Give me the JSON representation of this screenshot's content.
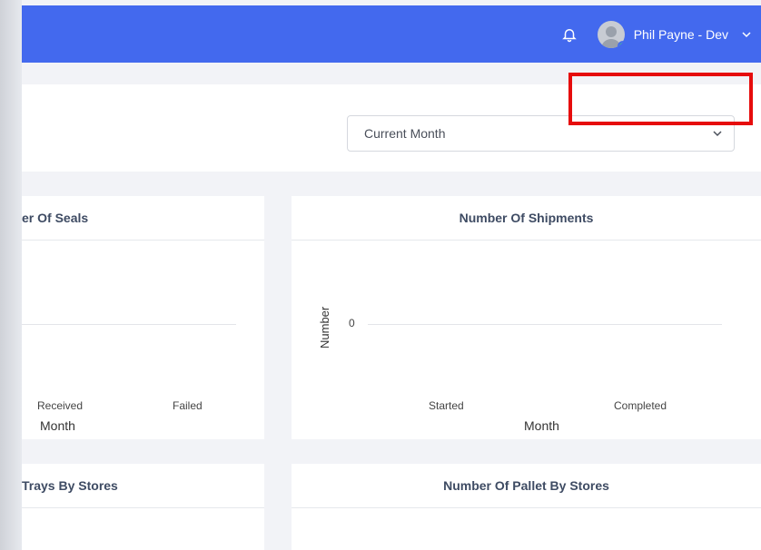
{
  "header": {
    "user_name": "Phil Payne - Dev",
    "bell_icon": "bell-icon",
    "avatar_icon": "user-avatar-icon",
    "dropdown_icon": "chevron-down-icon",
    "bar_color": "#4369ee"
  },
  "filter": {
    "period_value": "Current Month"
  },
  "cards": {
    "seals": {
      "title": "er Of Seals",
      "x_ticks": [
        "Received",
        "Failed"
      ],
      "x_title": "Month"
    },
    "shipments": {
      "title": "Number Of Shipments",
      "y_title": "Number",
      "y_tick": "0",
      "x_ticks": [
        "Started",
        "Completed"
      ],
      "x_title": "Month"
    },
    "trays": {
      "title": "Trays By Stores"
    },
    "pallets": {
      "title": "Number Of Pallet By Stores"
    }
  },
  "annotation": {
    "highlight_color": "#e60c0c"
  }
}
